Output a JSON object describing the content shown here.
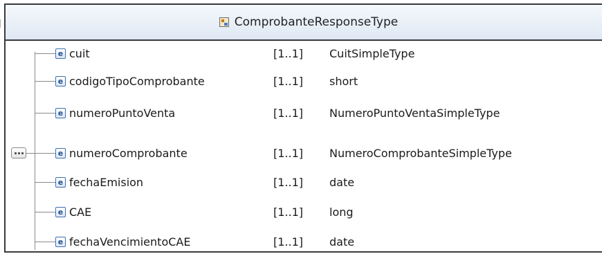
{
  "complex_type": {
    "name": "ComprobanteResponseType",
    "icon": "complex-type-icon"
  },
  "compositor": {
    "kind": "sequence",
    "icon": "sequence-icon"
  },
  "elements": [
    {
      "icon_letter": "e",
      "name": "cuit",
      "cardinality": "[1..1]",
      "type": "CuitSimpleType"
    },
    {
      "icon_letter": "e",
      "name": "codigoTipoComprobante",
      "cardinality": "[1..1]",
      "type": "short"
    },
    {
      "icon_letter": "e",
      "name": "numeroPuntoVenta",
      "cardinality": "[1..1]",
      "type": "NumeroPuntoVentaSimpleType"
    },
    {
      "icon_letter": "e",
      "name": "numeroComprobante",
      "cardinality": "[1..1]",
      "type": "NumeroComprobanteSimpleType"
    },
    {
      "icon_letter": "e",
      "name": "fechaEmision",
      "cardinality": "[1..1]",
      "type": "date"
    },
    {
      "icon_letter": "e",
      "name": "CAE",
      "cardinality": "[1..1]",
      "type": "long"
    },
    {
      "icon_letter": "e",
      "name": "fechaVencimientoCAE",
      "cardinality": "[1..1]",
      "type": "date"
    }
  ]
}
